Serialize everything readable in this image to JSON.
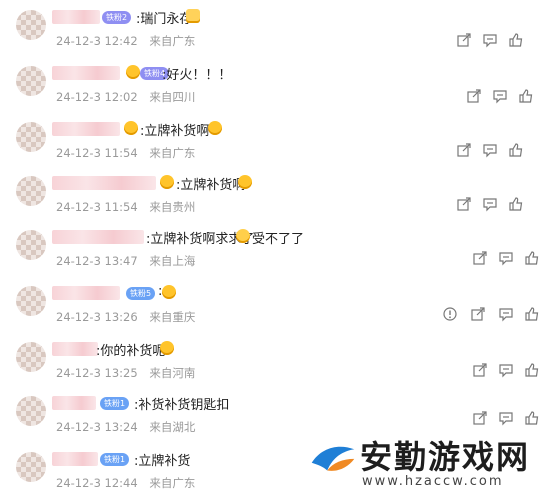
{
  "comments": [
    {
      "badge": "铁粉2",
      "badge_color": "purple",
      "message": ":瑞门永存",
      "time": "24-12-3 12:42",
      "location": "来自广东"
    },
    {
      "badge": "铁粉4",
      "badge_color": "purple",
      "message": ":好火！！！",
      "time": "24-12-3 12:02",
      "location": "来自四川"
    },
    {
      "badge": "",
      "badge_color": "",
      "message": ":立牌补货啊",
      "time": "24-12-3 11:54",
      "location": "来自广东"
    },
    {
      "badge": "",
      "badge_color": "",
      "message": ":立牌补货啊",
      "time": "24-12-3 11:54",
      "location": "来自贵州"
    },
    {
      "badge": "",
      "badge_color": "",
      "message": ":立牌补货啊求求了",
      "message_tail": "受不了了",
      "time": "24-12-3 13:47",
      "location": "来自上海"
    },
    {
      "badge": "铁粉5",
      "badge_color": "blue",
      "message": ":",
      "time": "24-12-3 13:26",
      "location": "来自重庆"
    },
    {
      "badge": "",
      "badge_color": "",
      "message": ":你的补货呢",
      "time": "24-12-3 13:25",
      "location": "来自河南"
    },
    {
      "badge": "铁粉1",
      "badge_color": "blue",
      "message": ":补货补货钥匙扣",
      "time": "24-12-3 13:24",
      "location": "来自湖北"
    },
    {
      "badge": "铁粉1",
      "badge_color": "blue",
      "message": ":立牌补货",
      "time": "24-12-3 12:44",
      "location": "来自广东"
    }
  ],
  "watermark": {
    "title": "安勤游戏网",
    "url": "www.hzaccw.com"
  },
  "icons": {
    "share": "share-icon",
    "reply": "comment-icon",
    "like": "thumbs-up-icon",
    "report": "report-icon"
  },
  "colors": {
    "meta_text": "#9a9a9a",
    "badge_purple": "#8f8ff2",
    "badge_blue": "#6aa2f5",
    "watermark_blue": "#1f7fd6"
  }
}
